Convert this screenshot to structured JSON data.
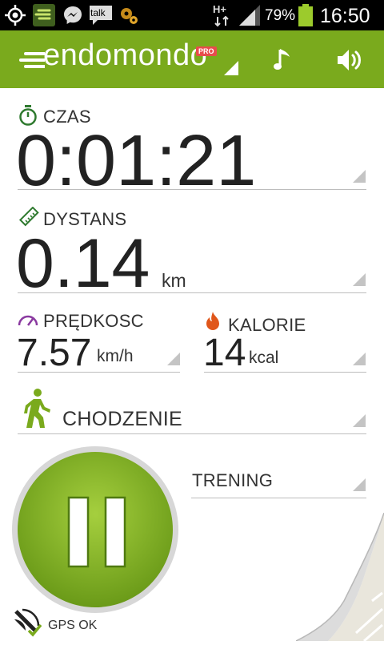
{
  "status_bar": {
    "network": "H+",
    "battery_percent": "79%",
    "time": "16:50",
    "notification_icons": [
      "gps-icon",
      "endomondo-notification-icon",
      "messenger-icon",
      "talk-icon",
      "settings-gear-icon"
    ],
    "talk_label": "talk"
  },
  "app_bar": {
    "logo_text": "endomondo",
    "pro_badge": "PRO",
    "color": "#7aaa1d",
    "icons": [
      "music-icon",
      "volume-icon"
    ]
  },
  "metrics": {
    "time": {
      "label": "CZAS",
      "value": "0:01:21",
      "icon": "stopwatch-icon"
    },
    "distance": {
      "label": "DYSTANS",
      "value": "0.14",
      "unit": "km",
      "icon": "ruler-icon"
    },
    "speed": {
      "label": "PRĘDKOSC",
      "value": "7.57",
      "unit": "km/h",
      "icon": "speedometer-icon"
    },
    "calories": {
      "label": "KALORIE",
      "value": "14",
      "unit": "kcal",
      "icon": "flame-icon"
    }
  },
  "sport": {
    "label": "CHODZENIE",
    "icon": "walking-person-icon"
  },
  "workout": {
    "label": "TRENING"
  },
  "pause_button": {
    "icon": "pause-icon",
    "color": "#7aaa1d"
  },
  "gps": {
    "label": "GPS OK",
    "icon": "gps-signal-icon"
  }
}
